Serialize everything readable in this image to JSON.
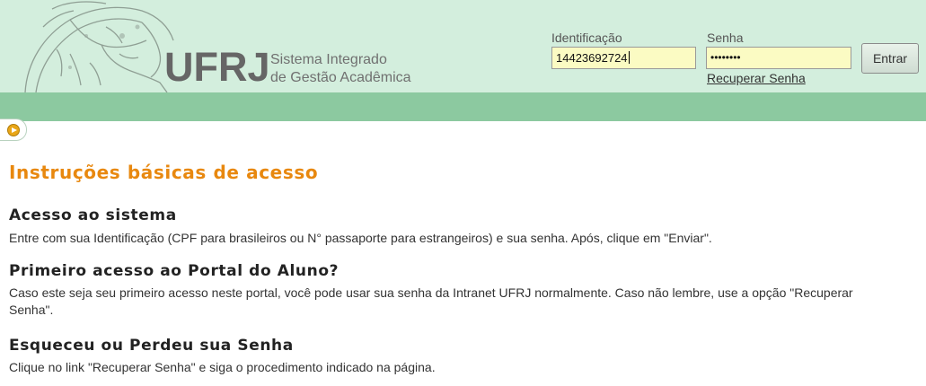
{
  "header": {
    "brand_name": "UFRJ",
    "brand_sub_line1": "Sistema Integrado",
    "brand_sub_line2": "de Gestão Acadêmica",
    "colors": {
      "header_bg": "#d3eedd",
      "bar_bg": "#8cc9a0",
      "input_bg": "#fbfbc3",
      "title_orange": "#e8880f"
    }
  },
  "login": {
    "id_label": "Identificação",
    "id_value": "14423692724",
    "password_label": "Senha",
    "password_value": "••••••••",
    "submit_label": "Entrar",
    "recover_link": "Recuperar Senha"
  },
  "side_tab": {
    "icon": "play-circle-icon"
  },
  "content": {
    "title": "Instruções básicas de acesso",
    "sections": [
      {
        "title": "Acesso ao sistema",
        "text": "Entre com sua Identificação (CPF para brasileiros ou N° passaporte para estrangeiros) e sua senha. Após, clique em \"Enviar\"."
      },
      {
        "title": "Primeiro acesso ao Portal do Aluno?",
        "text": "Caso este seja seu primeiro acesso neste portal, você pode usar sua senha da Intranet UFRJ normalmente. Caso não lembre, use a opção \"Recuperar Senha\"."
      },
      {
        "title": "Esqueceu ou Perdeu sua Senha",
        "text": "Clique no link \"Recuperar Senha\" e siga o procedimento indicado na página."
      }
    ]
  }
}
